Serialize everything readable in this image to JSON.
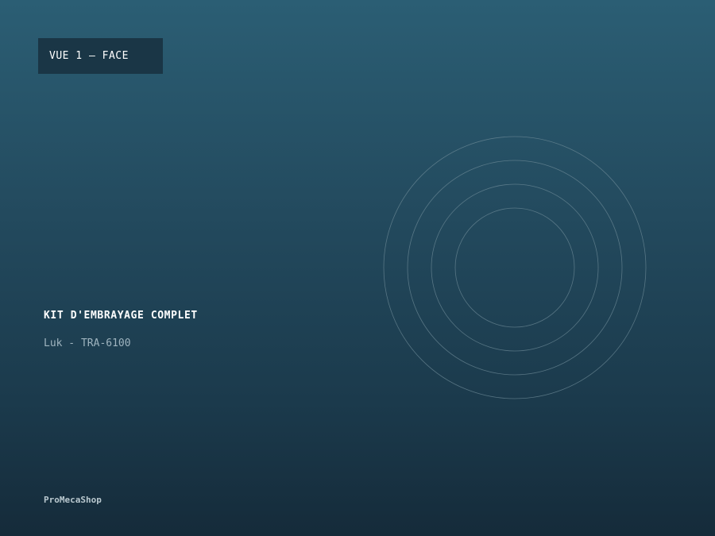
{
  "view_label": "VUE 1 — FACE",
  "product": {
    "title": "KIT D'EMBRAYAGE COMPLET",
    "subtitle": "Luk - TRA-6100"
  },
  "brand": "ProMecaShop",
  "colors": {
    "background_top": "#2b5e74",
    "background_bottom": "#152b3a",
    "badge_bg": "#1a3646",
    "ring_stroke": "#6f8c99"
  }
}
